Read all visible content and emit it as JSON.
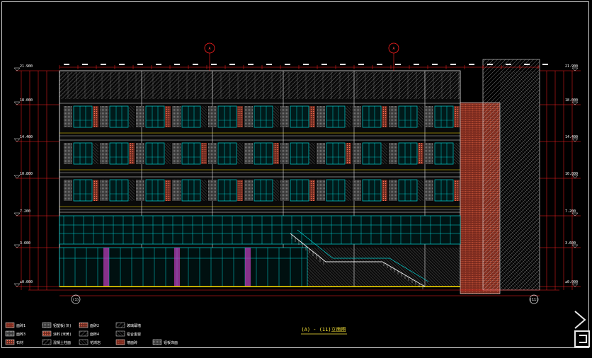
{
  "drawing": {
    "title": "(A) - (11)立面图",
    "axis_marks": {
      "top_left": "A",
      "top_right": "A",
      "bottom_left": "(1)",
      "bottom_right": "(11)"
    },
    "levels_left": [
      "21.900",
      "18.000",
      "14.400",
      "10.800",
      "7.200",
      "3.600",
      "±0.000"
    ],
    "levels_right": [
      "21.900",
      "18.000",
      "14.400",
      "10.800",
      "7.200",
      "3.600",
      "±0.000"
    ],
    "legend": [
      [
        "面砖1",
        "铝塑板(灰)",
        "面砖2",
        "玻璃幕墙"
      ],
      [
        "面砖3",
        "涂料(米黄)",
        "面砖4",
        "铝合金窗"
      ],
      [
        "石材",
        "混凝土柱面",
        "花岗岩",
        "墙面砖",
        "铝板饰面"
      ]
    ],
    "colors": {
      "background": "#000000",
      "facade_grid": "#00d4d4",
      "dimension": "#ff2020",
      "brick": "#c0503c",
      "ground": "#ffe000",
      "white_lines": "#e8e8e8"
    }
  }
}
